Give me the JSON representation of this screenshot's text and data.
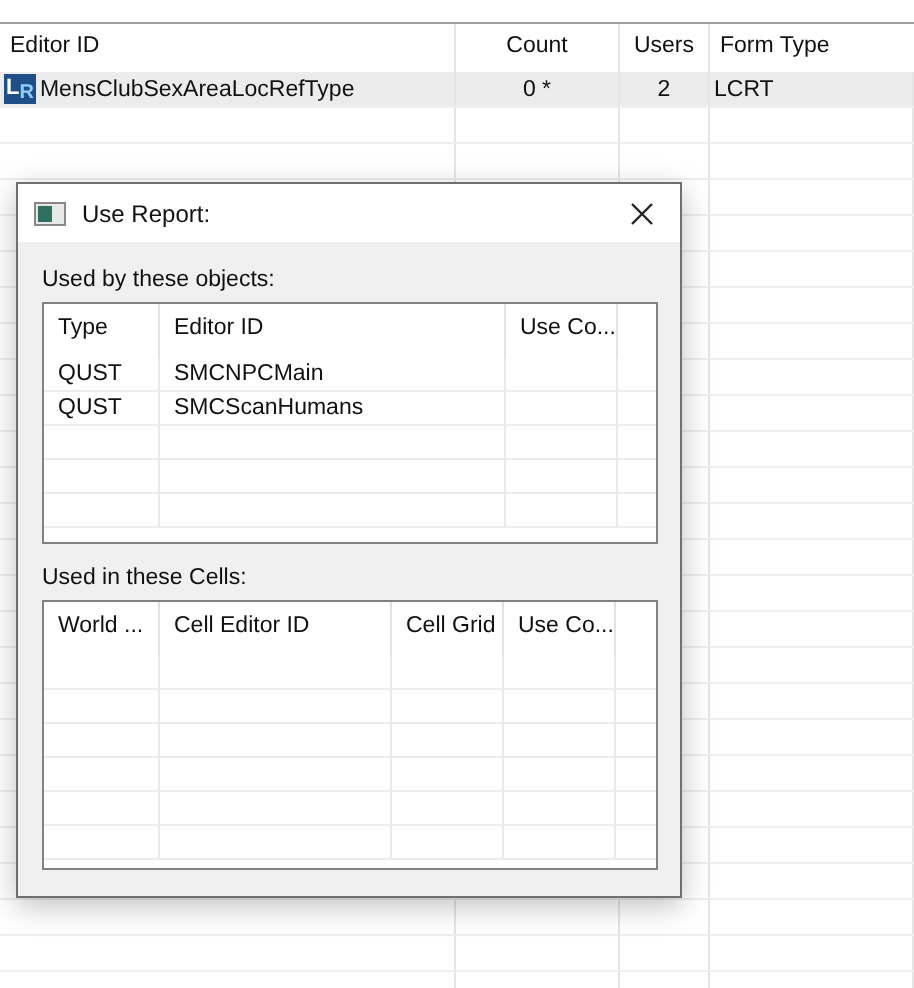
{
  "table": {
    "columns": [
      "Editor ID",
      "Count",
      "Users",
      "Form Type"
    ],
    "rows": [
      {
        "icon": "L$_{R}$",
        "editor_id": "MensClubSexAreaLocRefType",
        "count": "0 *",
        "users": "2",
        "form_type": "LCRT",
        "selected": true
      }
    ]
  },
  "dialog": {
    "title": "Use Report:",
    "objects": {
      "label": "Used by these objects:",
      "columns": [
        "Type",
        "Editor ID",
        "Use Co..."
      ],
      "rows": [
        [
          "QUST",
          "SMCNPCMain",
          ""
        ],
        [
          "QUST",
          "SMCScanHumans",
          ""
        ]
      ]
    },
    "cells": {
      "label": "Used in these Cells:",
      "columns": [
        "World ...",
        "Cell Editor ID",
        "Cell Grid",
        "Use Co..."
      ]
    }
  }
}
